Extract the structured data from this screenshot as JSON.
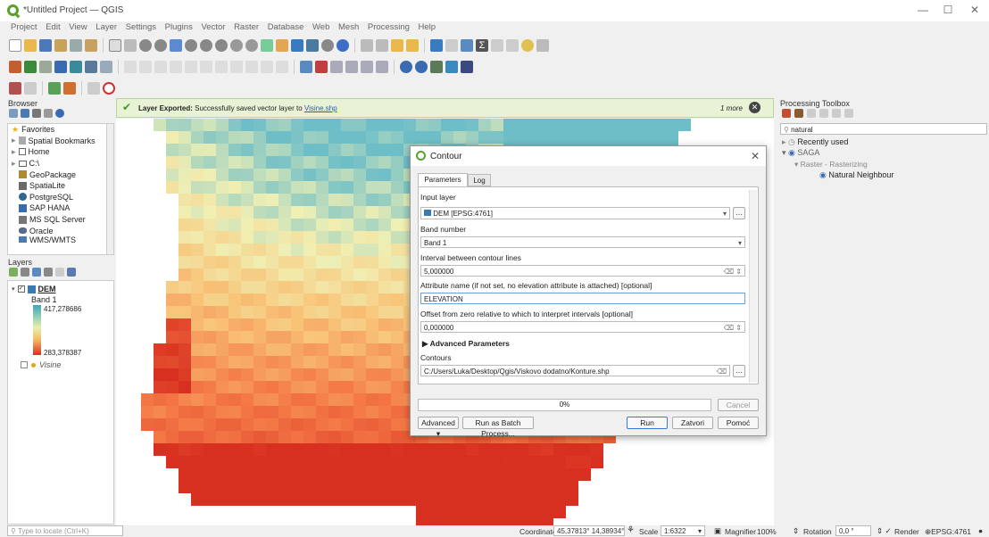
{
  "window": {
    "title": "*Untitled Project — QGIS",
    "minimize": "—",
    "maximize": "☐",
    "close": "✕"
  },
  "menu": [
    "Project",
    "Edit",
    "View",
    "Layer",
    "Settings",
    "Plugins",
    "Vector",
    "Raster",
    "Database",
    "Web",
    "Mesh",
    "Processing",
    "Help"
  ],
  "browser": {
    "title": "Browser",
    "items": [
      {
        "label": "Favorites",
        "icon": "star-icon"
      },
      {
        "label": "Spatial Bookmarks",
        "icon": "bookmark-icon"
      },
      {
        "label": "Home",
        "icon": "home-icon"
      },
      {
        "label": "C:\\",
        "icon": "drive-icon"
      },
      {
        "label": "GeoPackage",
        "icon": "geopackage-icon"
      },
      {
        "label": "SpatiaLite",
        "icon": "spatialite-icon"
      },
      {
        "label": "PostgreSQL",
        "icon": "postgresql-icon"
      },
      {
        "label": "SAP HANA",
        "icon": "hana-icon"
      },
      {
        "label": "MS SQL Server",
        "icon": "mssql-icon"
      },
      {
        "label": "Oracle",
        "icon": "oracle-icon"
      },
      {
        "label": "WMS/WMTS",
        "icon": "wms-icon"
      }
    ]
  },
  "layers": {
    "title": "Layers",
    "dem": "DEM",
    "band": "Band 1",
    "max": "417,278686",
    "min": "283,378387",
    "visine": "Visine"
  },
  "message": {
    "bold": "Layer Exported:",
    "text": "Successfully saved vector layer to",
    "link": "Visine.shp",
    "more": "1 more"
  },
  "toolbox": {
    "title": "Processing Toolbox",
    "search": "natural",
    "recent": "Recently used",
    "saga": "SAGA",
    "group": "Raster - Rasterizing",
    "alg": "Natural Neighbour"
  },
  "dialog": {
    "title": "Contour",
    "tabs": [
      "Parameters",
      "Log"
    ],
    "input_label": "Input layer",
    "input_value": "DEM [EPSG:4761]",
    "band_label": "Band number",
    "band_value": "Band 1",
    "interval_label": "Interval between contour lines",
    "interval_value": "5,000000",
    "attr_label": "Attribute name (if not set, no elevation attribute is attached) [optional]",
    "attr_value": "ELEVATION",
    "offset_label": "Offset from zero relative to which to interpret intervals [optional]",
    "offset_value": "0,000000",
    "advanced": "Advanced Parameters",
    "contours_label": "Contours",
    "contours_value": "C:/Users/Luka/Desktop/Qgis/Viskovo dodatno/Konture.shp",
    "progress": "0%",
    "cancel": "Cancel",
    "advanced_btn": "Advanced",
    "batch": "Run as Batch Process...",
    "run": "Run",
    "close": "Zatvori",
    "help": "Pomoć"
  },
  "status": {
    "locate": "Type to locate (Ctrl+K)",
    "coord_label": "Coordinate",
    "coord": "45,37813° 14,38934°",
    "scale_label": "Scale",
    "scale": "1:6322",
    "magnifier_label": "Magnifier",
    "magnifier": "100%",
    "rotation_label": "Rotation",
    "rotation": "0,0 °",
    "render": "Render",
    "crs": "EPSG:4761"
  }
}
